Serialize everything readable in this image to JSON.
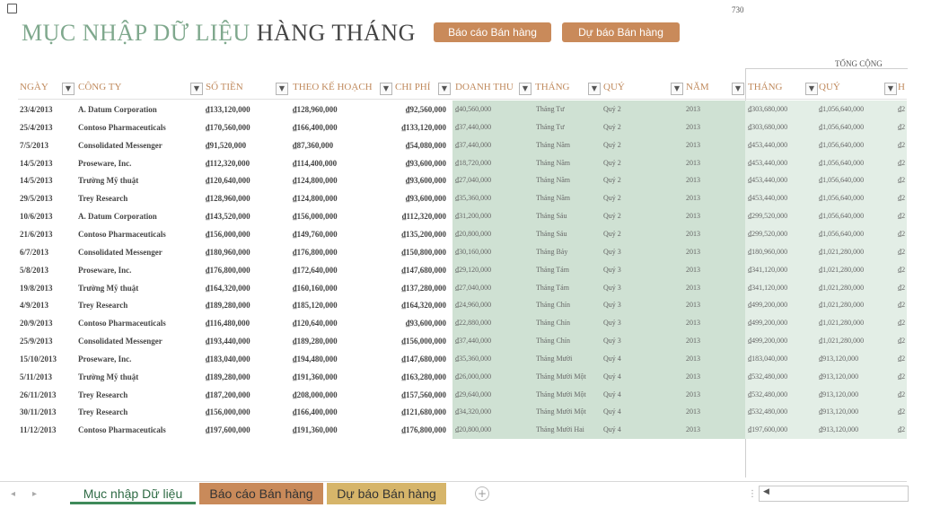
{
  "cell_ref": "730",
  "title": {
    "part1": "MỤC NHẬP DỮ LIỆU",
    "part2": "HÀNG THÁNG"
  },
  "buttons": {
    "sales_report": "Báo cáo Bán hàng",
    "sales_forecast": "Dự báo Bán hàng"
  },
  "total_group_label": "TỔNG CỘNG",
  "headers": {
    "date": "NGÀY",
    "company": "CÔNG TY",
    "amount": "SỐ TIỀN",
    "plan": "THEO KẾ HOẠCH",
    "cost": "CHI PHÍ",
    "revenue": "DOANH THU",
    "month": "THÁNG",
    "quarter": "QUÝ",
    "year": "NĂM",
    "total_month": "THÁNG",
    "total_quarter": "QUÝ",
    "total_h": "H"
  },
  "rows": [
    [
      "23/4/2013",
      "A. Datum Corporation",
      "₫133,120,000",
      "₫128,960,000",
      "₫92,560,000",
      "₫40,560,000",
      "Tháng Tư",
      "Quý 2",
      "2013",
      "₫303,680,000",
      "₫1,056,640,000",
      "₫2"
    ],
    [
      "25/4/2013",
      "Contoso Pharmaceuticals",
      "₫170,560,000",
      "₫166,400,000",
      "₫133,120,000",
      "₫37,440,000",
      "Tháng Tư",
      "Quý 2",
      "2013",
      "₫303,680,000",
      "₫1,056,640,000",
      "₫2"
    ],
    [
      "7/5/2013",
      "Consolidated Messenger",
      "₫91,520,000",
      "₫87,360,000",
      "₫54,080,000",
      "₫37,440,000",
      "Tháng Năm",
      "Quý 2",
      "2013",
      "₫453,440,000",
      "₫1,056,640,000",
      "₫2"
    ],
    [
      "14/5/2013",
      "Proseware, Inc.",
      "₫112,320,000",
      "₫114,400,000",
      "₫93,600,000",
      "₫18,720,000",
      "Tháng Năm",
      "Quý 2",
      "2013",
      "₫453,440,000",
      "₫1,056,640,000",
      "₫2"
    ],
    [
      "14/5/2013",
      "Trường Mỹ thuật",
      "₫120,640,000",
      "₫124,800,000",
      "₫93,600,000",
      "₫27,040,000",
      "Tháng Năm",
      "Quý 2",
      "2013",
      "₫453,440,000",
      "₫1,056,640,000",
      "₫2"
    ],
    [
      "29/5/2013",
      "Trey Research",
      "₫128,960,000",
      "₫124,800,000",
      "₫93,600,000",
      "₫35,360,000",
      "Tháng Năm",
      "Quý 2",
      "2013",
      "₫453,440,000",
      "₫1,056,640,000",
      "₫2"
    ],
    [
      "10/6/2013",
      "A. Datum Corporation",
      "₫143,520,000",
      "₫156,000,000",
      "₫112,320,000",
      "₫31,200,000",
      "Tháng Sáu",
      "Quý 2",
      "2013",
      "₫299,520,000",
      "₫1,056,640,000",
      "₫2"
    ],
    [
      "21/6/2013",
      "Contoso Pharmaceuticals",
      "₫156,000,000",
      "₫149,760,000",
      "₫135,200,000",
      "₫20,800,000",
      "Tháng Sáu",
      "Quý 2",
      "2013",
      "₫299,520,000",
      "₫1,056,640,000",
      "₫2"
    ],
    [
      "6/7/2013",
      "Consolidated Messenger",
      "₫180,960,000",
      "₫176,800,000",
      "₫150,800,000",
      "₫30,160,000",
      "Tháng Bảy",
      "Quý 3",
      "2013",
      "₫180,960,000",
      "₫1,021,280,000",
      "₫2"
    ],
    [
      "5/8/2013",
      "Proseware, Inc.",
      "₫176,800,000",
      "₫172,640,000",
      "₫147,680,000",
      "₫29,120,000",
      "Tháng Tám",
      "Quý 3",
      "2013",
      "₫341,120,000",
      "₫1,021,280,000",
      "₫2"
    ],
    [
      "19/8/2013",
      "Trường Mỹ thuật",
      "₫164,320,000",
      "₫160,160,000",
      "₫137,280,000",
      "₫27,040,000",
      "Tháng Tám",
      "Quý 3",
      "2013",
      "₫341,120,000",
      "₫1,021,280,000",
      "₫2"
    ],
    [
      "4/9/2013",
      "Trey Research",
      "₫189,280,000",
      "₫185,120,000",
      "₫164,320,000",
      "₫24,960,000",
      "Tháng Chín",
      "Quý 3",
      "2013",
      "₫499,200,000",
      "₫1,021,280,000",
      "₫2"
    ],
    [
      "20/9/2013",
      "Contoso Pharmaceuticals",
      "₫116,480,000",
      "₫120,640,000",
      "₫93,600,000",
      "₫22,880,000",
      "Tháng Chín",
      "Quý 3",
      "2013",
      "₫499,200,000",
      "₫1,021,280,000",
      "₫2"
    ],
    [
      "25/9/2013",
      "Consolidated Messenger",
      "₫193,440,000",
      "₫189,280,000",
      "₫156,000,000",
      "₫37,440,000",
      "Tháng Chín",
      "Quý 3",
      "2013",
      "₫499,200,000",
      "₫1,021,280,000",
      "₫2"
    ],
    [
      "15/10/2013",
      "Proseware, Inc.",
      "₫183,040,000",
      "₫194,480,000",
      "₫147,680,000",
      "₫35,360,000",
      "Tháng Mười",
      "Quý 4",
      "2013",
      "₫183,040,000",
      "₫913,120,000",
      "₫2"
    ],
    [
      "5/11/2013",
      "Trường Mỹ thuật",
      "₫189,280,000",
      "₫191,360,000",
      "₫163,280,000",
      "₫26,000,000",
      "Tháng Mười Một",
      "Quý 4",
      "2013",
      "₫532,480,000",
      "₫913,120,000",
      "₫2"
    ],
    [
      "26/11/2013",
      "Trey Research",
      "₫187,200,000",
      "₫208,000,000",
      "₫157,560,000",
      "₫29,640,000",
      "Tháng Mười Một",
      "Quý 4",
      "2013",
      "₫532,480,000",
      "₫913,120,000",
      "₫2"
    ],
    [
      "30/11/2013",
      "Trey Research",
      "₫156,000,000",
      "₫166,400,000",
      "₫121,680,000",
      "₫34,320,000",
      "Tháng Mười Một",
      "Quý 4",
      "2013",
      "₫532,480,000",
      "₫913,120,000",
      "₫2"
    ],
    [
      "11/12/2013",
      "Contoso Pharmaceuticals",
      "₫197,600,000",
      "₫191,360,000",
      "₫176,800,000",
      "₫20,800,000",
      "Tháng Mười Hai",
      "Quý 4",
      "2013",
      "₫197,600,000",
      "₫913,120,000",
      "₫2"
    ]
  ],
  "sheet_tabs": [
    "Mục nhập Dữ liệu",
    "Báo cáo Bán hàng",
    "Dự báo Bán hàng"
  ],
  "add_sheet_symbol": "+",
  "colors": {
    "accent_green": "#7fa88d",
    "header_tan": "#c08a5d",
    "button_tan": "#c98a5a",
    "tab_gold": "#d6b56a",
    "band_green": "#cfe1d3"
  }
}
